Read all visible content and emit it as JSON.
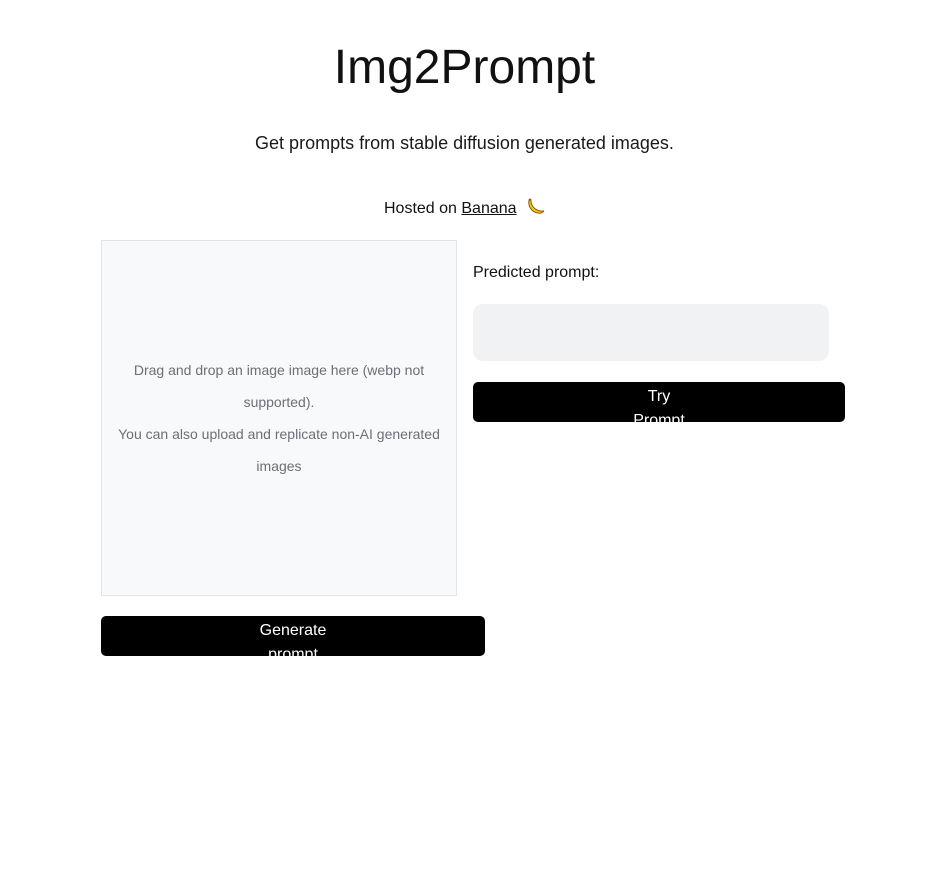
{
  "header": {
    "title": "Img2Prompt",
    "subtitle": "Get prompts from stable diffusion generated images.",
    "hosted_prefix": "Hosted on",
    "hosted_link": "Banana",
    "hosted_icon": "banana-icon"
  },
  "dropzone": {
    "line1": "Drag and drop an image image here (webp not supported).",
    "line2": "You can also upload and replicate non-AI generated images"
  },
  "prediction": {
    "label": "Predicted prompt:",
    "value": ""
  },
  "buttons": {
    "try_prompt": "Try Prompt",
    "generate_prompt": "Generate prompt"
  },
  "colors": {
    "button_bg": "#000000",
    "button_text": "#ffffff",
    "dropzone_bg": "#f8f9fa",
    "input_bg": "#f1f2f4"
  }
}
